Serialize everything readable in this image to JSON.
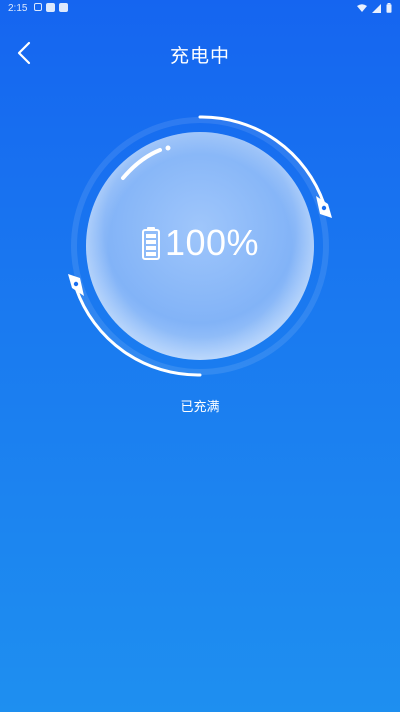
{
  "status_bar": {
    "time": "2:15",
    "icons_left": [
      "notification-icon-a",
      "notification-icon-b",
      "notification-icon-c"
    ],
    "icons_right": [
      "wifi-icon",
      "signal-icon",
      "battery-status-icon"
    ]
  },
  "header": {
    "back_icon": "chevron-left-icon",
    "title": "充电中"
  },
  "charging": {
    "percent_text": "100%",
    "battery_level": 1.0,
    "status_text": "已充满"
  },
  "colors": {
    "background_top": "#1565f0",
    "background_bottom": "#1e8ff0",
    "text": "#ffffff"
  }
}
